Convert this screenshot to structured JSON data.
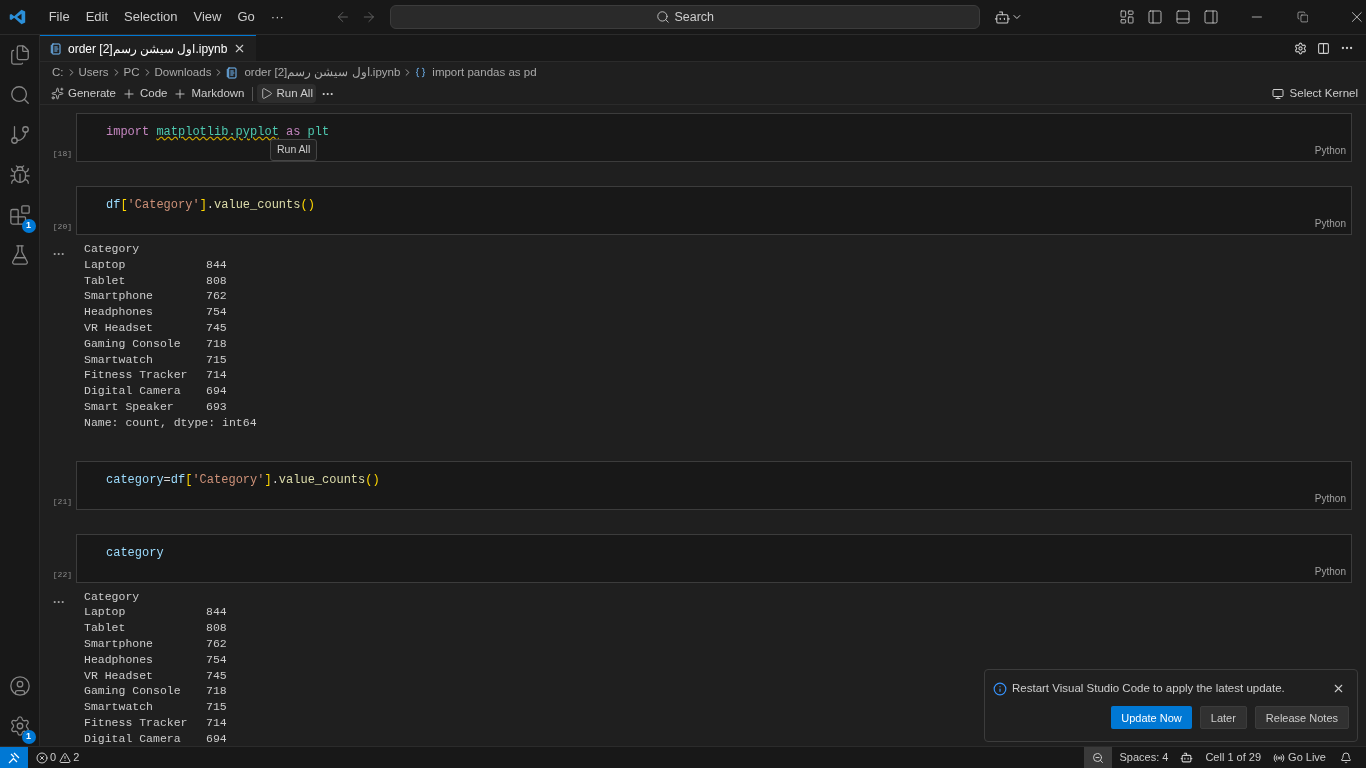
{
  "menu": [
    "File",
    "Edit",
    "Selection",
    "View",
    "Go",
    "···"
  ],
  "command_center": {
    "label": "Search"
  },
  "tab": {
    "title": "order [2]اول سيشن رسم.ipynb",
    "selected": true
  },
  "breadcrumbs": [
    {
      "label": "C:",
      "kind": "folder"
    },
    {
      "label": "Users",
      "kind": "folder"
    },
    {
      "label": "PC",
      "kind": "folder"
    },
    {
      "label": "Downloads",
      "kind": "folder"
    },
    {
      "label": "order [2]اول سيشن رسم.ipynb",
      "kind": "notebook"
    },
    {
      "label": "import pandas as pd",
      "kind": "symbol"
    }
  ],
  "toolbar": [
    {
      "label": "Generate",
      "kind": "sparkle",
      "hovered": false
    },
    {
      "label": "Code",
      "kind": "plus",
      "hovered": false
    },
    {
      "label": "Markdown",
      "kind": "plus",
      "hovered": false
    },
    {
      "label": "Run All",
      "kind": "run",
      "hovered": true
    }
  ],
  "toolbar_more": "···",
  "tooltip": "Run All",
  "kernel": "Select Kernel",
  "activity_badges": {
    "extensions": "1",
    "manage": "1"
  },
  "cells": [
    {
      "count": "[18]",
      "language": "Python",
      "spaced": true,
      "code": [
        {
          "text": "import",
          "kind": "keyword"
        },
        {
          "text": "matplotlib.pyplot",
          "kind": "module",
          "warning": true
        },
        {
          "text": "as",
          "kind": "keyword"
        },
        {
          "text": "plt",
          "kind": "module"
        }
      ]
    },
    {
      "count": "[20]",
      "language": "Python",
      "spaced": false,
      "code": [
        {
          "text": "df",
          "kind": "variable"
        },
        {
          "text": "[",
          "kind": "bracket"
        },
        {
          "text": "'Category'",
          "kind": "string"
        },
        {
          "text": "]",
          "kind": "bracket"
        },
        {
          "text": ".",
          "kind": "plain"
        },
        {
          "text": "value_counts",
          "kind": "function"
        },
        {
          "text": "()",
          "kind": "bracket"
        }
      ],
      "output": {
        "marker": "···",
        "header": "Category",
        "rows": [
          {
            "name": "Laptop",
            "count": "844"
          },
          {
            "name": "Tablet",
            "count": "808"
          },
          {
            "name": "Smartphone",
            "count": "762"
          },
          {
            "name": "Headphones",
            "count": "754"
          },
          {
            "name": "VR Headset",
            "count": "745"
          },
          {
            "name": "Gaming Console",
            "count": "718"
          },
          {
            "name": "Smartwatch",
            "count": "715"
          },
          {
            "name": "Fitness Tracker",
            "count": "714"
          },
          {
            "name": "Digital Camera",
            "count": "694"
          },
          {
            "name": "Smart Speaker",
            "count": "693"
          }
        ],
        "footer": "Name: count, dtype: int64"
      }
    },
    {
      "count": "[21]",
      "language": "Python",
      "spaced": false,
      "code": [
        {
          "text": "category",
          "kind": "variable"
        },
        {
          "text": "=",
          "kind": "plain"
        },
        {
          "text": "df",
          "kind": "variable"
        },
        {
          "text": "[",
          "kind": "bracket"
        },
        {
          "text": "'Category'",
          "kind": "string"
        },
        {
          "text": "]",
          "kind": "bracket"
        },
        {
          "text": ".",
          "kind": "plain"
        },
        {
          "text": "value_counts",
          "kind": "function"
        },
        {
          "text": "()",
          "kind": "bracket"
        }
      ]
    },
    {
      "count": "[22]",
      "language": "Python",
      "code": [
        {
          "text": "category",
          "kind": "variable"
        }
      ],
      "output": {
        "marker": "···",
        "header": "Category",
        "rows": [
          {
            "name": "Laptop",
            "count": "844"
          },
          {
            "name": "Tablet",
            "count": "808"
          },
          {
            "name": "Smartphone",
            "count": "762"
          },
          {
            "name": "Headphones",
            "count": "754"
          },
          {
            "name": "VR Headset",
            "count": "745"
          },
          {
            "name": "Gaming Console",
            "count": "718"
          },
          {
            "name": "Smartwatch",
            "count": "715"
          },
          {
            "name": "Fitness Tracker",
            "count": "714"
          },
          {
            "name": "Digital Camera",
            "count": "694"
          }
        ]
      }
    }
  ],
  "notification": {
    "message": "Restart Visual Studio Code to apply the latest update.",
    "buttons": [
      {
        "label": "Update Now",
        "primary": true
      },
      {
        "label": "Later",
        "primary": false
      },
      {
        "label": "Release Notes",
        "primary": false
      }
    ]
  },
  "status_bar": {
    "errors": "0",
    "warnings": "2",
    "spaces": "Spaces: 4",
    "cell": "Cell 1 of 29",
    "live": "Go Live"
  }
}
